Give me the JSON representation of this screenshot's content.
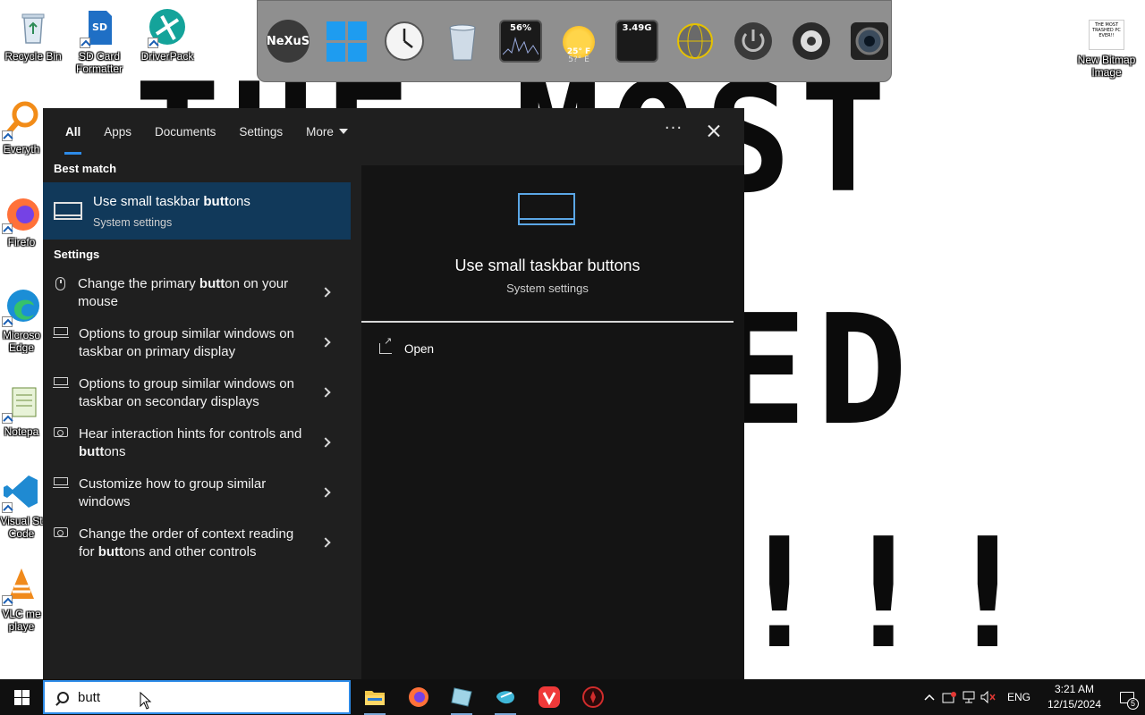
{
  "wallpaper": {
    "line1": "THE MOST",
    "line2": "ED",
    "line3": "!!!"
  },
  "desktop_icons": [
    {
      "label": "Recycle Bin",
      "icon": "recycle-bin-icon"
    },
    {
      "label": "SD Card Formatter",
      "icon": "sd-card-icon"
    },
    {
      "label": "DriverPack",
      "icon": "driverpack-icon"
    },
    {
      "label": "New Bitmap Image",
      "icon": "bitmap-image-icon",
      "thumbnail_text": "THE MOST TRASHED PC EVER!!"
    },
    {
      "label": "Everyth",
      "icon": "everything-search-icon"
    },
    {
      "label": "Firefo",
      "icon": "firefox-icon"
    },
    {
      "label": "Microso Edge",
      "icon": "edge-icon"
    },
    {
      "label": "Notepa",
      "icon": "notepad-icon"
    },
    {
      "label": "Visual St Code",
      "icon": "vscode-icon"
    },
    {
      "label": "VLC me playe",
      "icon": "vlc-icon"
    }
  ],
  "dock": {
    "items": [
      {
        "name": "nexus-icon",
        "text": "NeXuS"
      },
      {
        "name": "windows-icon",
        "text": ""
      },
      {
        "name": "clock-icon",
        "text": ""
      },
      {
        "name": "trash-icon",
        "text": ""
      },
      {
        "name": "cpu-meter-icon",
        "text": "56%"
      },
      {
        "name": "weather-icon",
        "text": "25° F",
        "sub": "5?° E"
      },
      {
        "name": "memory-meter-icon",
        "text": "3.49G"
      },
      {
        "name": "globe-icon",
        "text": ""
      },
      {
        "name": "power-icon",
        "text": ""
      },
      {
        "name": "speaker-icon",
        "text": ""
      },
      {
        "name": "camera-icon",
        "text": ""
      }
    ]
  },
  "search": {
    "tabs": [
      {
        "label": "All",
        "active": true
      },
      {
        "label": "Apps"
      },
      {
        "label": "Documents"
      },
      {
        "label": "Settings"
      },
      {
        "label": "More"
      }
    ],
    "best_match_header": "Best match",
    "best_match": {
      "title_pre": "Use small taskbar ",
      "title_bold": "butt",
      "title_post": "ons",
      "subtitle": "System settings"
    },
    "settings_header": "Settings",
    "results": [
      {
        "icon": "mouse-icon",
        "pre": "Change the primary ",
        "bold": "butt",
        "post": "on on your mouse"
      },
      {
        "icon": "taskbar-icon",
        "pre": "Options to group similar windows on taskbar on primary display",
        "bold": "",
        "post": ""
      },
      {
        "icon": "taskbar-icon",
        "pre": "Options to group similar windows on taskbar on secondary displays",
        "bold": "",
        "post": ""
      },
      {
        "icon": "narrator-icon",
        "pre": "Hear interaction hints for controls and ",
        "bold": "butt",
        "post": "ons"
      },
      {
        "icon": "taskbar-icon",
        "pre": "Customize how to group similar windows",
        "bold": "",
        "post": ""
      },
      {
        "icon": "narrator-icon",
        "pre": "Change the order of context reading for ",
        "bold": "butt",
        "post": "ons and other controls"
      }
    ],
    "preview": {
      "title": "Use small taskbar buttons",
      "subtitle": "System settings",
      "open_label": "Open"
    },
    "query": "butt"
  },
  "taskbar": {
    "apps": [
      "file-explorer-icon",
      "firefox-icon",
      "notepad-icon",
      "app-icon",
      "vivaldi-icon",
      "app-red-icon"
    ],
    "tray": {
      "language": "ENG",
      "time": "3:21 AM",
      "date": "12/15/2024",
      "notification_count": "5"
    }
  },
  "colors": {
    "accent": "#2d8be8",
    "panel_bg": "#1f1f1f",
    "preview_bg": "#141414",
    "selection_bg": "#11395a",
    "taskbar_bg": "#101010"
  }
}
